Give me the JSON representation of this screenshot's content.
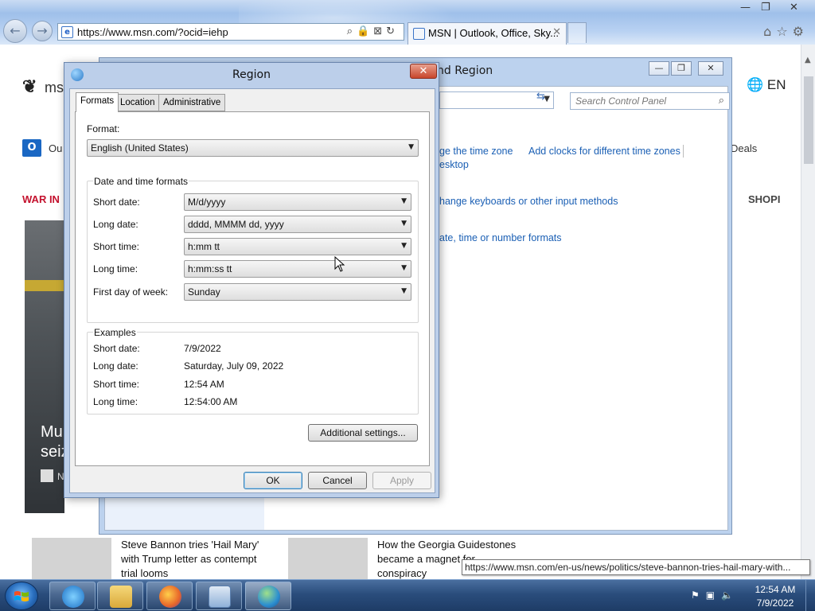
{
  "browser": {
    "url": "https://www.msn.com/?ocid=iehp",
    "tab_title": "MSN | Outlook, Office, Sky...",
    "minimize": "—",
    "restore": "❐",
    "close": "✕"
  },
  "msn": {
    "logo_text": "ms",
    "language": "EN",
    "outlook_label": "Ou",
    "deals_label": "Deals",
    "war_label": "WAR IN",
    "shop_label": "SHOPI",
    "hero_caption_1": "Mu",
    "hero_caption_2": "seiz",
    "hero_source_letter": "N",
    "card1_title": "Steve Bannon tries 'Hail Mary' with Trump letter as contempt trial looms",
    "card2_title": "How the Georgia Guidestones became a magnet for conspiracy"
  },
  "control_panel": {
    "title": "nd Region",
    "search_placeholder": "Search Control Panel",
    "link_time_zone": "ge the time zone",
    "link_clocks": "Add clocks for different time zones",
    "link_desktop": "esktop",
    "link_keyboards": "hange keyboards or other input methods",
    "link_formats": "ate, time or number formats"
  },
  "region_dialog": {
    "title": "Region",
    "tabs": [
      "Formats",
      "Location",
      "Administrative"
    ],
    "format_label": "Format:",
    "format_value": "English (United States)",
    "dt_group_label": "Date and time formats",
    "short_date_label": "Short date:",
    "short_date_value": "M/d/yyyy",
    "long_date_label": "Long date:",
    "long_date_value": "dddd, MMMM dd, yyyy",
    "short_time_label": "Short time:",
    "short_time_value": "h:mm tt",
    "long_time_label": "Long time:",
    "long_time_value": "h:mm:ss tt",
    "first_day_label": "First day of week:",
    "first_day_value": "Sunday",
    "examples_label": "Examples",
    "ex_short_date_label": "Short date:",
    "ex_short_date_value": "7/9/2022",
    "ex_long_date_label": "Long date:",
    "ex_long_date_value": "Saturday, July 09, 2022",
    "ex_short_time_label": "Short time:",
    "ex_short_time_value": "12:54 AM",
    "ex_long_time_label": "Long time:",
    "ex_long_time_value": "12:54:00 AM",
    "additional_settings": "Additional settings...",
    "ok": "OK",
    "cancel": "Cancel",
    "apply": "Apply"
  },
  "status_url": "https://www.msn.com/en-us/news/politics/steve-bannon-tries-hail-mary-with...",
  "taskbar": {
    "items": [
      "internet-explorer",
      "file-explorer",
      "firefox",
      "control-panel",
      "region-settings"
    ],
    "time": "12:54 AM",
    "date": "7/9/2022"
  }
}
